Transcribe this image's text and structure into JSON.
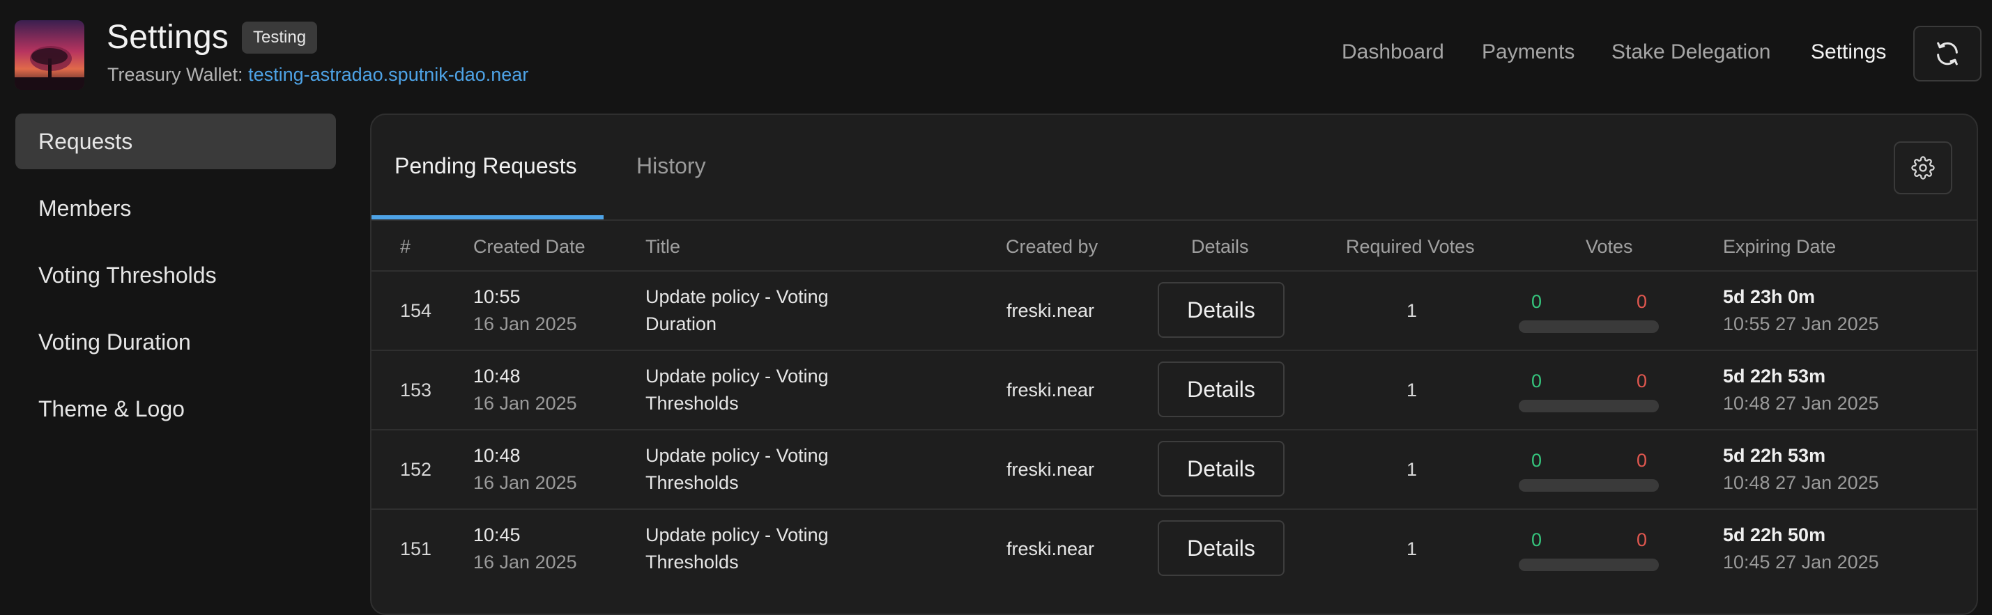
{
  "header": {
    "title": "Settings",
    "badge": "Testing",
    "wallet_label": "Treasury Wallet:",
    "wallet_address": "testing-astradao.sputnik-dao.near",
    "nav": [
      "Dashboard",
      "Payments",
      "Stake Delegation",
      "Settings"
    ],
    "active_nav": "Settings",
    "refresh_icon": "refresh-icon",
    "logo_icon": "dao-logo"
  },
  "sidebar": {
    "items": [
      {
        "label": "Requests",
        "active": true
      },
      {
        "label": "Members",
        "active": false
      },
      {
        "label": "Voting Thresholds",
        "active": false
      },
      {
        "label": "Voting Duration",
        "active": false
      },
      {
        "label": "Theme & Logo",
        "active": false
      }
    ]
  },
  "tabs": {
    "pending": "Pending Requests",
    "history": "History",
    "active": "Pending Requests",
    "settings_icon": "gear-icon"
  },
  "table": {
    "columns": {
      "id": "#",
      "created": "Created Date",
      "title": "Title",
      "created_by": "Created by",
      "details": "Details",
      "required_votes": "Required Votes",
      "votes": "Votes",
      "expiring": "Expiring Date"
    },
    "rows": [
      {
        "id": "154",
        "time": "10:55",
        "date": "16 Jan 2025",
        "title_line1": "Update policy - Voting",
        "title_line2": "Duration",
        "creator": "freski.near",
        "details_label": "Details",
        "required": "1",
        "yes": "0",
        "no": "0",
        "progress": 0,
        "exp_main": "5d 23h 0m",
        "exp_sub": "10:55 27 Jan 2025"
      },
      {
        "id": "153",
        "time": "10:48",
        "date": "16 Jan 2025",
        "title_line1": "Update policy - Voting",
        "title_line2": "Thresholds",
        "creator": "freski.near",
        "details_label": "Details",
        "required": "1",
        "yes": "0",
        "no": "0",
        "progress": 0,
        "exp_main": "5d 22h 53m",
        "exp_sub": "10:48 27 Jan 2025"
      },
      {
        "id": "152",
        "time": "10:48",
        "date": "16 Jan 2025",
        "title_line1": "Update policy - Voting",
        "title_line2": "Thresholds",
        "creator": "freski.near",
        "details_label": "Details",
        "required": "1",
        "yes": "0",
        "no": "0",
        "progress": 0,
        "exp_main": "5d 22h 53m",
        "exp_sub": "10:48 27 Jan 2025"
      },
      {
        "id": "151",
        "time": "10:45",
        "date": "16 Jan 2025",
        "title_line1": "Update policy - Voting",
        "title_line2": "Thresholds",
        "creator": "freski.near",
        "details_label": "Details",
        "required": "1",
        "yes": "0",
        "no": "0",
        "progress": 0,
        "exp_main": "5d 22h 50m",
        "exp_sub": "10:45 27 Jan 2025"
      }
    ]
  },
  "colors": {
    "accent": "#4ea3e6",
    "vote_yes": "#35c47c",
    "vote_no": "#e0574f",
    "background": "#141414",
    "card": "#1e1e1e"
  }
}
